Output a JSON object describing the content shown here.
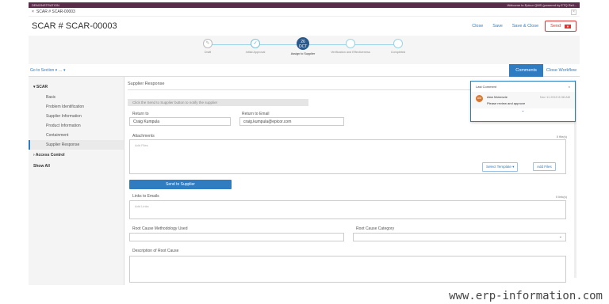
{
  "topbar": {
    "left": "DEMONSTRATION",
    "right": "Welcome to Epicor QMS (powered by ETQ Reli..."
  },
  "tab": {
    "close": "×",
    "label": "SCAR # SCAR-00003",
    "close_box": "×"
  },
  "header": {
    "title": "SCAR # SCAR-00003",
    "buttons": [
      "Close",
      "Save",
      "Save & Close"
    ],
    "send": "Send"
  },
  "stepper": {
    "steps": [
      {
        "icon": "",
        "label": "Draft"
      },
      {
        "icon": "",
        "label": "Initial Approval"
      },
      {
        "icon": "26\nOCT",
        "label": "Assign to Supplier"
      },
      {
        "icon": "",
        "label": "Verification and Effectiveness"
      },
      {
        "icon": "",
        "label": "Completed"
      }
    ]
  },
  "workbar": {
    "goto": "Go to Section",
    "comments": "Comments",
    "close_workflow": "Close Workflow"
  },
  "sidebar": {
    "section": "SCAR",
    "items": [
      "Basic",
      "Problem Identification",
      "Supplier Information",
      "Product Information",
      "Containment",
      "Supplier Response"
    ],
    "section2": "Access Control",
    "section3": "Show All"
  },
  "content": {
    "section_title": "Supplier Response",
    "hint": "Click the Send to Supplier button to notify the supplier",
    "return_to_label": "Return to",
    "return_to_value": "Craig Kumpula",
    "return_email_label": "Return to Email",
    "return_email_value": "craig.kumpula@epicor.com",
    "attachments_label": "Attachments",
    "attachments_count": "0 file(s)",
    "attachments_placeholder": "Add Files",
    "select_template": "Select Template",
    "add_files": "Add Files",
    "send_to_supplier": "Send to Supplier",
    "links_label": "Links to Emails",
    "links_count": "0 link(s)",
    "links_placeholder": "Add Links",
    "rc_method_label": "Root Cause Methodology Used",
    "rc_category_label": "Root Cause Category",
    "desc_label": "Description of Root Cause"
  },
  "comment_popup": {
    "title": "Last Comment",
    "author": "Alan Mckenzie",
    "initials": "AM",
    "date": "Nov 11 2019 8:38 AM",
    "text": "Please review and approve"
  },
  "watermark": "www.erp-information.com"
}
